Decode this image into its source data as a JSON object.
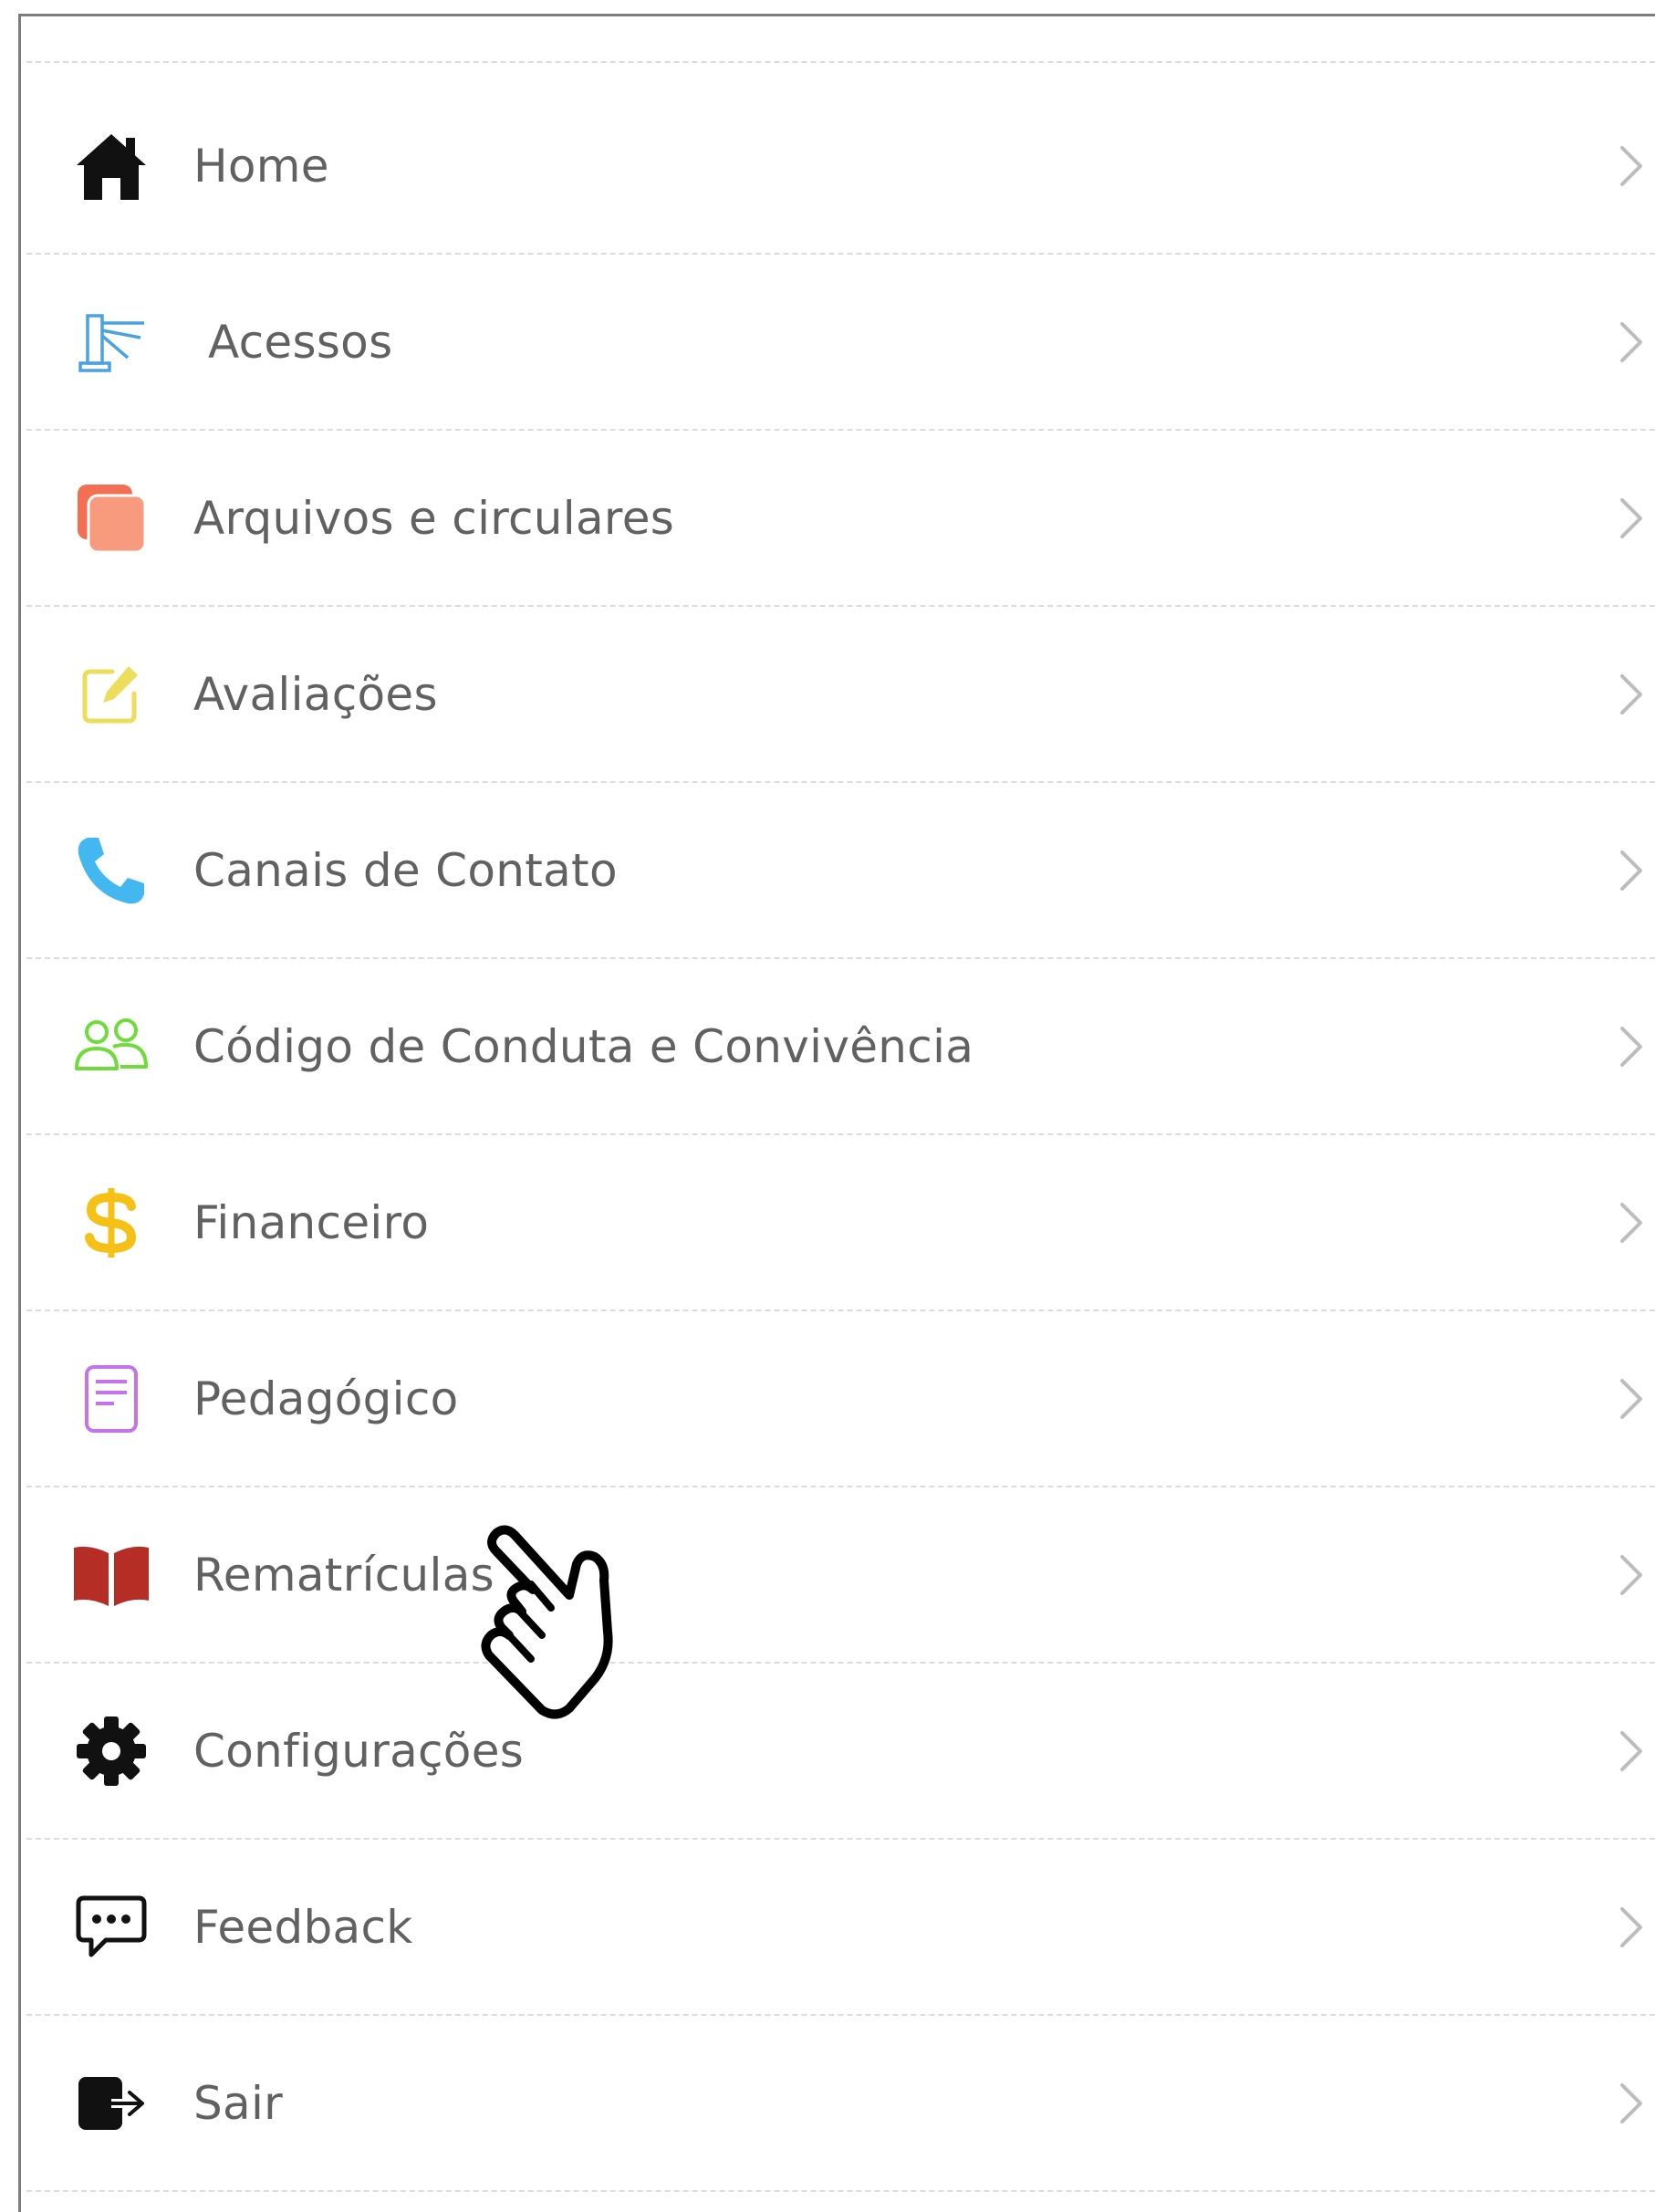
{
  "menu": {
    "items": [
      {
        "label": "Home",
        "icon": "home-icon"
      },
      {
        "label": "Acessos",
        "icon": "turnstile-icon"
      },
      {
        "label": "Arquivos e circulares",
        "icon": "files-icon"
      },
      {
        "label": "Avaliações",
        "icon": "edit-icon"
      },
      {
        "label": "Canais de Contato",
        "icon": "phone-icon"
      },
      {
        "label": "Código de Conduta e Convivência",
        "icon": "users-icon"
      },
      {
        "label": "Financeiro",
        "icon": "dollar-icon"
      },
      {
        "label": "Pedagógico",
        "icon": "document-icon"
      },
      {
        "label": "Rematrículas",
        "icon": "book-icon"
      },
      {
        "label": "Configurações",
        "icon": "gear-icon"
      },
      {
        "label": "Feedback",
        "icon": "chat-icon"
      },
      {
        "label": "Sair",
        "icon": "logout-icon"
      }
    ]
  },
  "colors": {
    "label": "#616161",
    "separator": "#dcdcdc",
    "chevron": "#bdbdbd",
    "turnstile": "#4aa3df",
    "files": "#f79a7e",
    "edit": "#eddd5c",
    "phone": "#43b7f0",
    "users": "#6fdc3c",
    "dollar": "#f5c116",
    "document": "#c573ea",
    "book": "#b52d24"
  }
}
